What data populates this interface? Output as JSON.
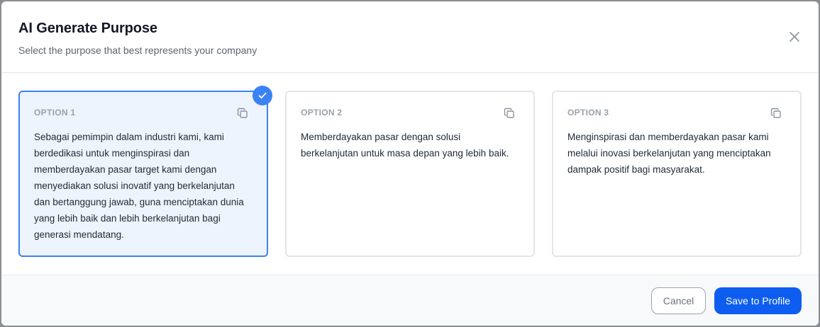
{
  "dialog": {
    "title": "AI Generate Purpose",
    "subtitle": "Select the purpose that best represents your company",
    "close_icon": "close-icon"
  },
  "options": [
    {
      "label": "OPTION 1",
      "text": "Sebagai pemimpin dalam industri kami, kami berdedikasi untuk menginspirasi dan memberdayakan pasar target kami dengan menyediakan solusi inovatif yang berkelanjutan dan bertanggung jawab, guna menciptakan dunia yang lebih baik dan lebih berkelanjutan bagi generasi mendatang.",
      "selected": true,
      "copy_icon": "copy-icon"
    },
    {
      "label": "OPTION 2",
      "text": "Memberdayakan pasar dengan solusi berkelanjutan untuk masa depan yang lebih baik.",
      "selected": false,
      "copy_icon": "copy-icon"
    },
    {
      "label": "OPTION 3",
      "text": "Menginspirasi dan memberdayakan pasar kami melalui inovasi berkelanjutan yang menciptakan dampak positif bagi masyarakat.",
      "selected": false,
      "copy_icon": "copy-icon"
    }
  ],
  "footer": {
    "cancel_label": "Cancel",
    "save_label": "Save to Profile"
  },
  "colors": {
    "accent": "#3b82f6",
    "primary_button": "#0d5ef0",
    "selected_card_bg": "#eef4fd"
  }
}
